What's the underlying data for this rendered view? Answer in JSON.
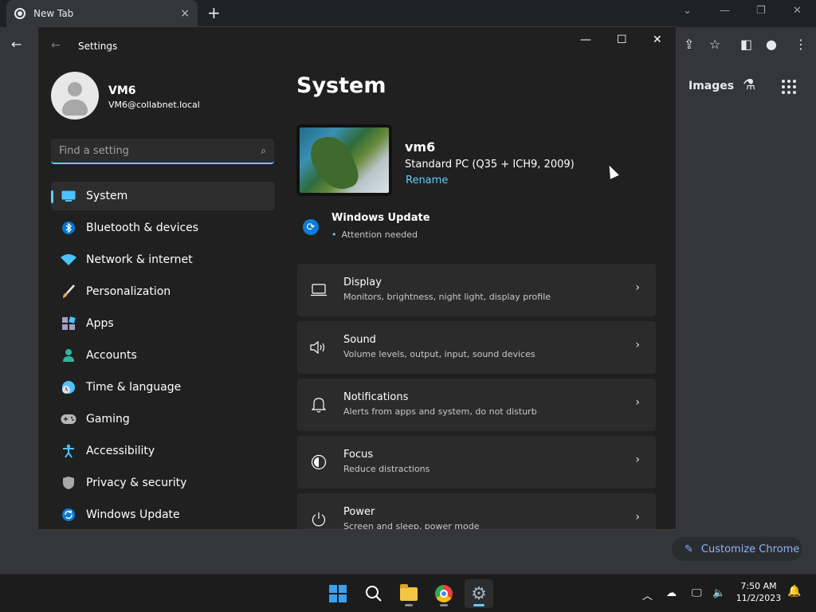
{
  "browser": {
    "tab_title": "New Tab",
    "tab_close": "×",
    "new_tab": "+",
    "minimize": "—",
    "restore": "❐",
    "close": "✕",
    "images_link": "Images",
    "customize_label": "Customize Chrome"
  },
  "settings": {
    "app_title": "Settings",
    "user": {
      "name": "VM6",
      "email": "VM6@collabnet.local"
    },
    "search_placeholder": "Find a setting",
    "nav": [
      {
        "label": "System",
        "icon": "monitor-icon",
        "color": "#4cc2ff",
        "active": true
      },
      {
        "label": "Bluetooth & devices",
        "icon": "bluetooth-icon",
        "color": "#0078d4"
      },
      {
        "label": "Network & internet",
        "icon": "wifi-icon",
        "color": "#4cc2ff"
      },
      {
        "label": "Personalization",
        "icon": "brush-icon",
        "color": "#e8a060"
      },
      {
        "label": "Apps",
        "icon": "apps-icon",
        "color": "#a0a0c8"
      },
      {
        "label": "Accounts",
        "icon": "person-icon",
        "color": "#2fb59a"
      },
      {
        "label": "Time & language",
        "icon": "globe-clock-icon",
        "color": "#4cc2ff"
      },
      {
        "label": "Gaming",
        "icon": "gamepad-icon",
        "color": "#b8b8b8"
      },
      {
        "label": "Accessibility",
        "icon": "accessibility-icon",
        "color": "#4cc2ff"
      },
      {
        "label": "Privacy & security",
        "icon": "shield-icon",
        "color": "#a8a8a8"
      },
      {
        "label": "Windows Update",
        "icon": "update-icon",
        "color": "#0e7cd6"
      }
    ],
    "page_title": "System",
    "device": {
      "name": "vm6",
      "model": "Standard PC (Q35 + ICH9, 2009)",
      "rename": "Rename"
    },
    "windows_update": {
      "title": "Windows Update",
      "status": "Attention needed"
    },
    "cards": [
      {
        "title": "Display",
        "subtitle": "Monitors, brightness, night light, display profile",
        "icon": "display-icon"
      },
      {
        "title": "Sound",
        "subtitle": "Volume levels, output, input, sound devices",
        "icon": "speaker-icon"
      },
      {
        "title": "Notifications",
        "subtitle": "Alerts from apps and system, do not disturb",
        "icon": "bell-icon"
      },
      {
        "title": "Focus",
        "subtitle": "Reduce distractions",
        "icon": "focus-icon"
      },
      {
        "title": "Power",
        "subtitle": "Screen and sleep, power mode",
        "icon": "power-icon"
      }
    ]
  },
  "taskbar": {
    "time": "7:50 AM",
    "date": "11/2/2023"
  }
}
